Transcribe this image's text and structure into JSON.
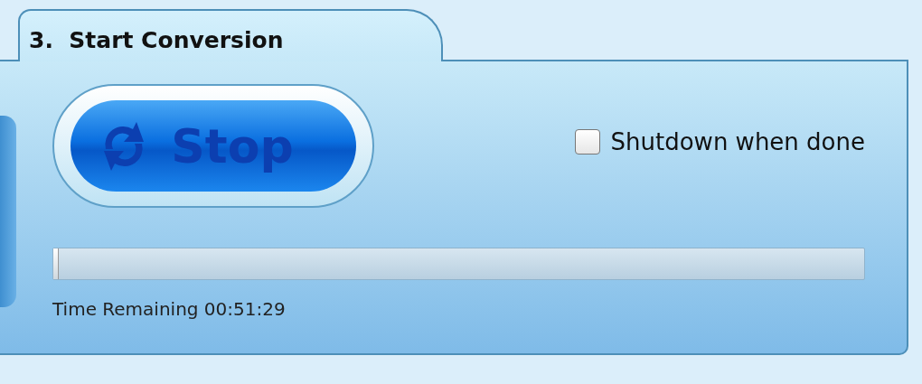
{
  "tab": {
    "title": "3.  Start Conversion"
  },
  "stop_button": {
    "label": "Stop"
  },
  "shutdown_checkbox": {
    "label": "Shutdown when done",
    "checked": false
  },
  "progress": {
    "level": 0.006
  },
  "time_remaining": "Time Remaining 00:51:29"
}
